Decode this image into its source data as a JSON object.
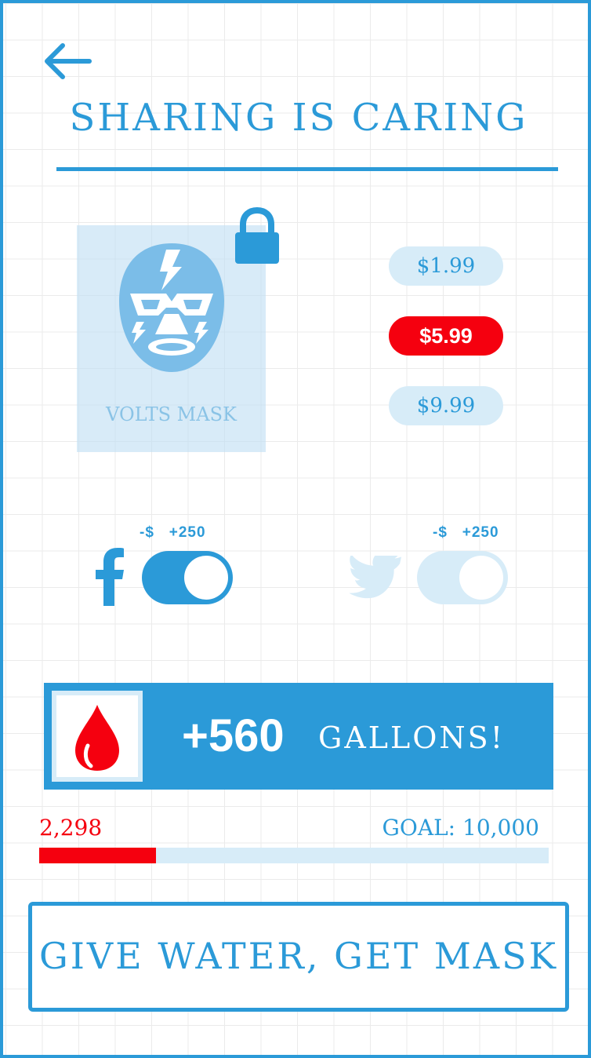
{
  "header": {
    "title": "SHARING IS CARING"
  },
  "mask": {
    "name": "VOLTS MASK",
    "locked": true
  },
  "prices": [
    {
      "label": "$1.99",
      "selected": false
    },
    {
      "label": "$5.99",
      "selected": true
    },
    {
      "label": "$9.99",
      "selected": false
    }
  ],
  "share": {
    "facebook": {
      "note_cost": "-$",
      "note_bonus": "+250",
      "enabled": true
    },
    "twitter": {
      "note_cost": "-$",
      "note_bonus": "+250",
      "enabled": false
    }
  },
  "reward": {
    "amount": "+560",
    "unit": "GALLONS!"
  },
  "progress": {
    "current": "2,298",
    "goal": "GOAL: 10,000",
    "fraction": 0.2298
  },
  "cta": {
    "label": "GIVE WATER, GET MASK"
  },
  "colors": {
    "accent": "#2b9ad8",
    "alert": "#f5000f",
    "light": "#d7ecf8"
  },
  "icons": [
    "back-arrow-icon",
    "lock-icon",
    "mask-icon",
    "facebook-icon",
    "twitter-icon",
    "water-drop-icon"
  ]
}
